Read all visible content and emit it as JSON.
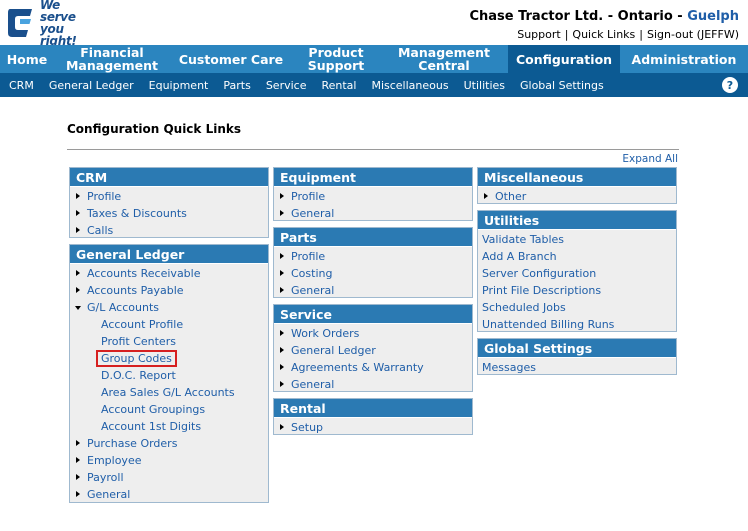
{
  "header": {
    "logo_line1": "We serve",
    "logo_line2": "you right!",
    "company": "Chase Tractor Ltd. - Ontario - ",
    "location": "Guelph",
    "links": [
      "Support",
      "Quick Links",
      "Sign-out (JEFFW)"
    ]
  },
  "mainnav": [
    {
      "label": "Home"
    },
    {
      "label": "Financial Management"
    },
    {
      "label": "Customer Care"
    },
    {
      "label": "Product Support"
    },
    {
      "label": "Management Central"
    },
    {
      "label": "Configuration"
    },
    {
      "label": "Administration"
    }
  ],
  "subnav": [
    "CRM",
    "General Ledger",
    "Equipment",
    "Parts",
    "Service",
    "Rental",
    "Miscellaneous",
    "Utilities",
    "Global Settings"
  ],
  "help_label": "?",
  "page": {
    "title": "Configuration Quick Links",
    "expand_all": "Expand All"
  },
  "panels": {
    "crm": {
      "title": "CRM",
      "items": [
        "Profile",
        "Taxes & Discounts",
        "Calls"
      ]
    },
    "gl": {
      "title": "General Ledger",
      "items_top": [
        "Accounts Receivable",
        "Accounts Payable"
      ],
      "expanded": "G/L Accounts",
      "sub_items": [
        "Account Profile",
        "Profit Centers",
        "Group Codes",
        "D.O.C. Report",
        "Area Sales G/L Accounts",
        "Account Groupings",
        "Account 1st Digits"
      ],
      "items_bottom": [
        "Purchase Orders",
        "Employee",
        "Payroll",
        "General"
      ]
    },
    "equipment": {
      "title": "Equipment",
      "items": [
        "Profile",
        "General"
      ]
    },
    "parts": {
      "title": "Parts",
      "items": [
        "Profile",
        "Costing",
        "General"
      ]
    },
    "service": {
      "title": "Service",
      "items": [
        "Work Orders",
        "General Ledger",
        "Agreements & Warranty",
        "General"
      ]
    },
    "rental": {
      "title": "Rental",
      "items": [
        "Setup"
      ]
    },
    "misc": {
      "title": "Miscellaneous",
      "items": [
        "Other"
      ]
    },
    "utilities": {
      "title": "Utilities",
      "items": [
        "Validate Tables",
        "Add A Branch",
        "Server Configuration",
        "Print File Descriptions",
        "Scheduled Jobs",
        "Unattended Billing Runs"
      ]
    },
    "global": {
      "title": "Global Settings",
      "items": [
        "Messages"
      ]
    }
  }
}
